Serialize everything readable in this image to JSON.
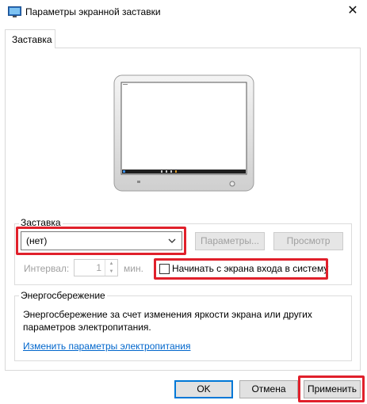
{
  "window": {
    "title": "Параметры экранной заставки",
    "close_glyph": "✕"
  },
  "tab": {
    "label": "Заставка"
  },
  "screensaver": {
    "group_label": "Заставка",
    "selected": "(нет)",
    "settings_label": "Параметры...",
    "preview_label": "Просмотр",
    "interval_label": "Интервал:",
    "interval_value": "1",
    "interval_unit": "мин.",
    "resume_label": "Начинать с экрана входа в систему",
    "resume_checked": false
  },
  "power": {
    "group_label": "Энергосбережение",
    "description": "Энергосбережение за счет изменения яркости экрана или других параметров электропитания.",
    "link_label": "Изменить параметры электропитания"
  },
  "footer": {
    "ok_label": "OK",
    "cancel_label": "Отмена",
    "apply_label": "Применить"
  },
  "colors": {
    "highlight": "#e0202b",
    "link": "#0066cc",
    "focus_border": "#0078d7"
  },
  "icons": {
    "app": "screensaver-app-icon",
    "close": "close-icon",
    "dropdown": "chevron-down-icon",
    "spin_up": "spin-up-icon",
    "spin_down": "spin-down-icon"
  }
}
